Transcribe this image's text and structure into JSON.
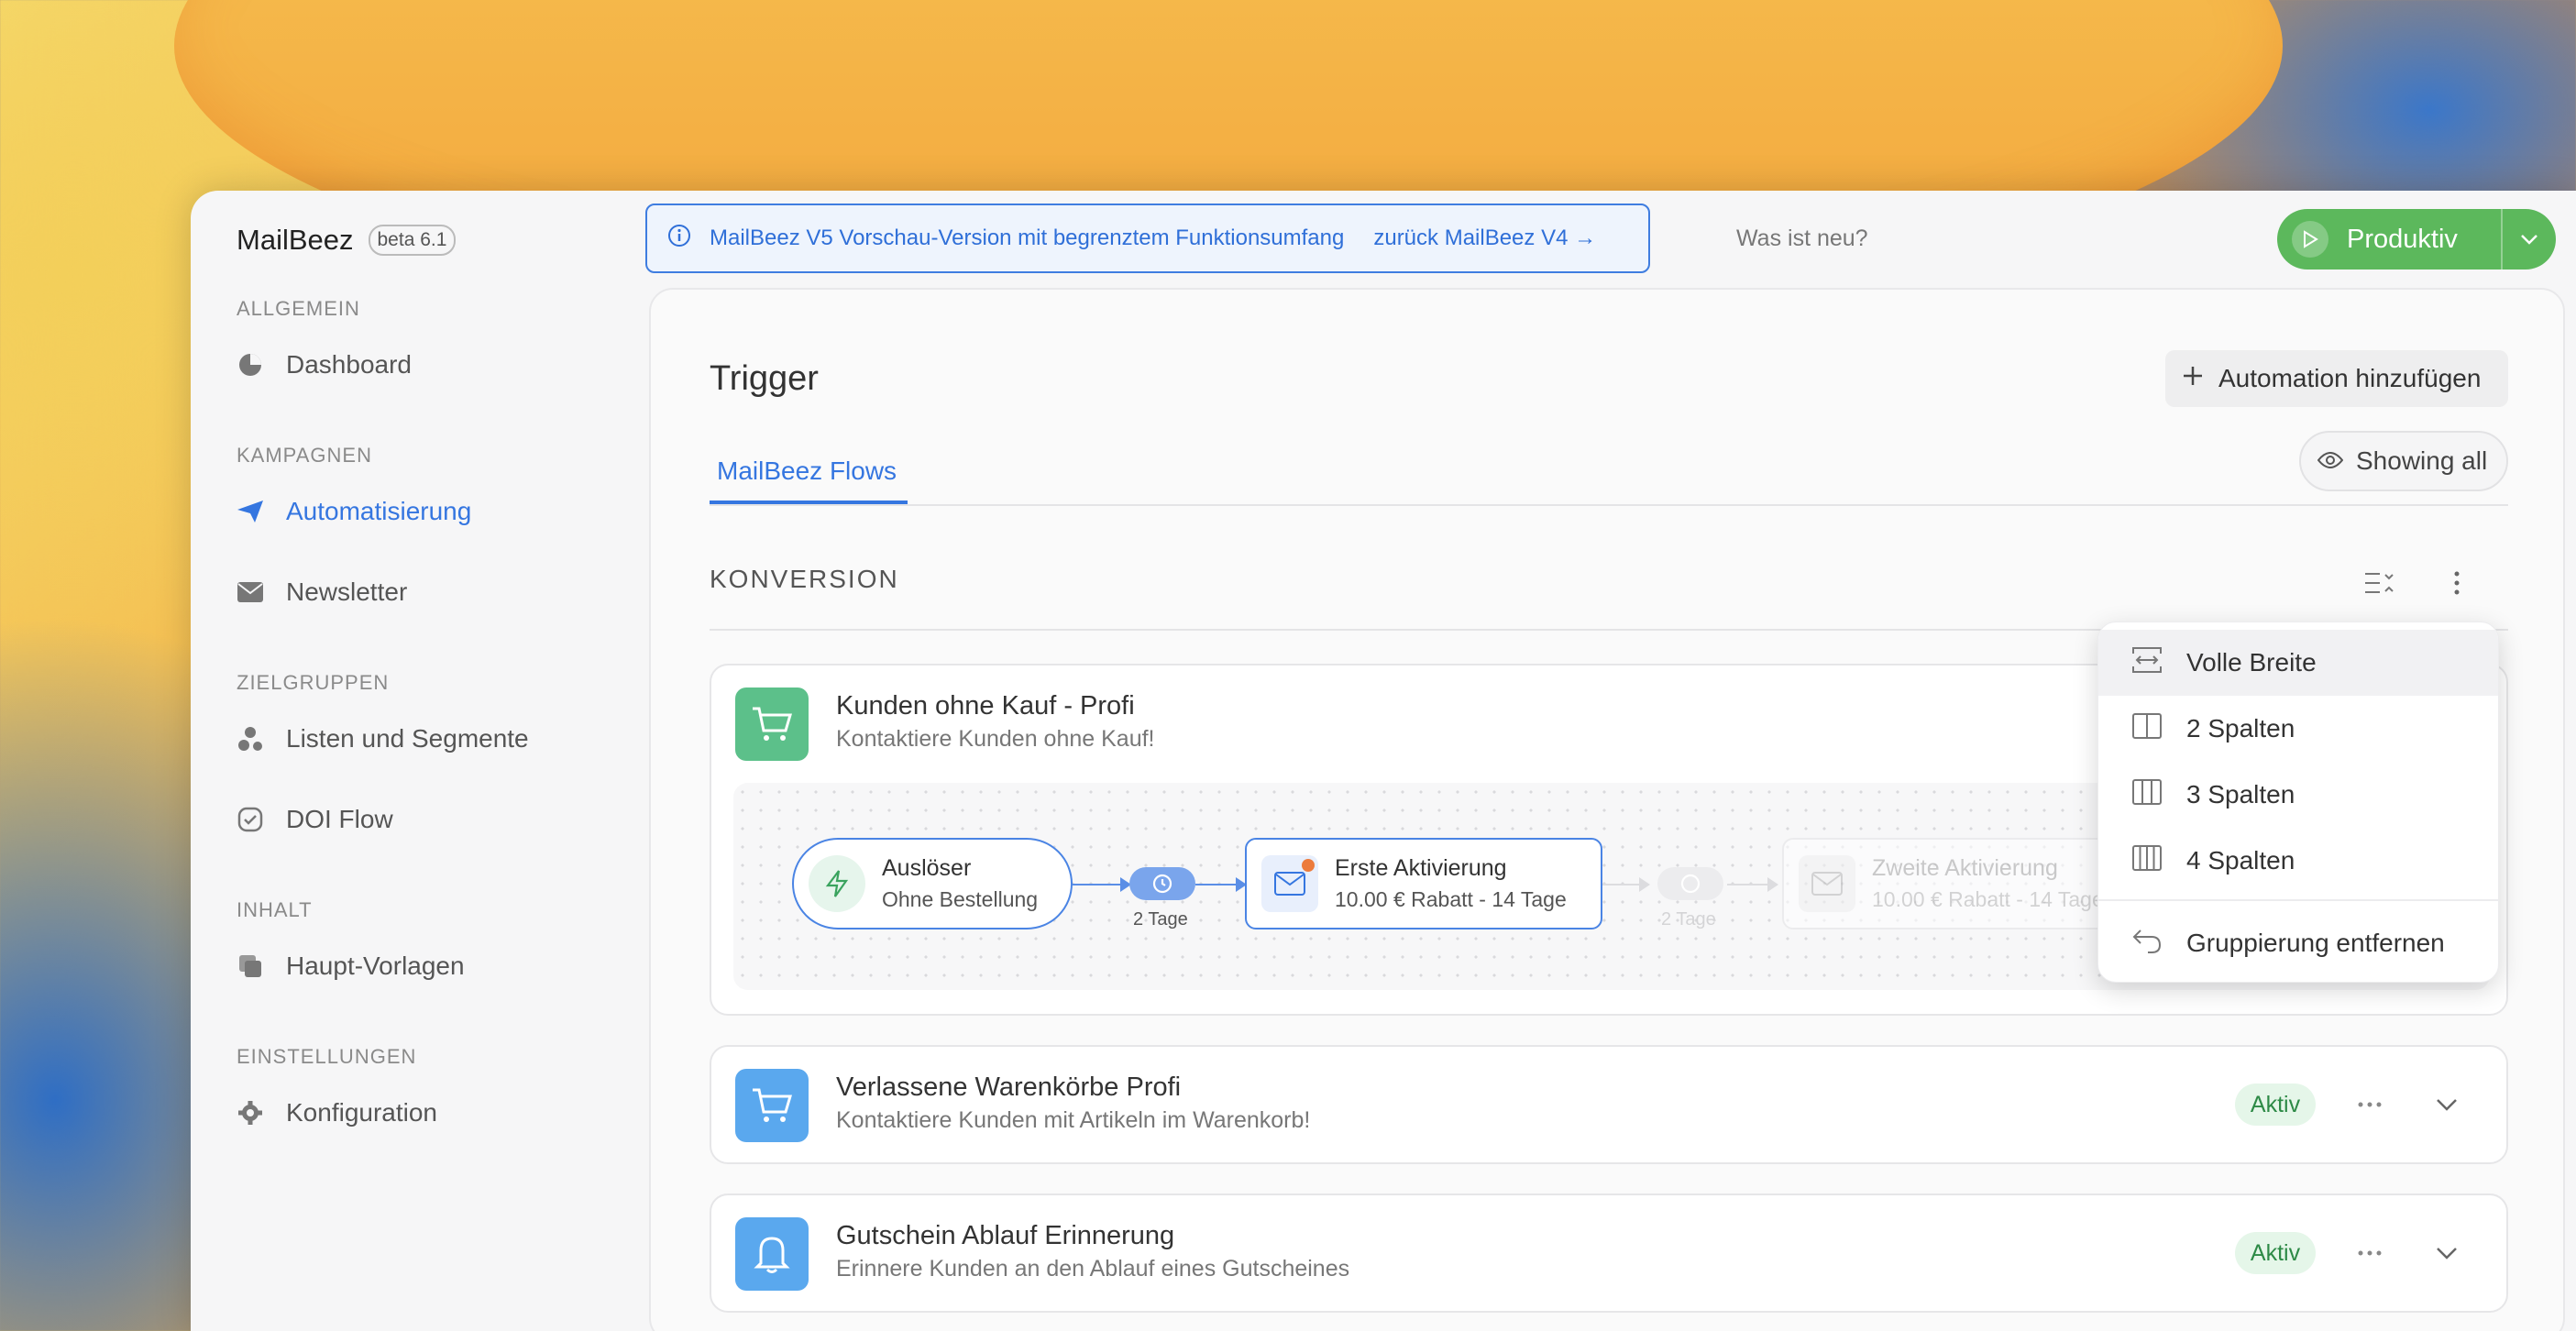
{
  "brand": {
    "name": "MailBeez",
    "badge": "beta 6.1"
  },
  "sidebar": {
    "sections": [
      {
        "label": "ALLGEMEIN",
        "items": [
          {
            "label": "Dashboard",
            "icon": "pie-chart-icon"
          }
        ]
      },
      {
        "label": "KAMPAGNEN",
        "items": [
          {
            "label": "Automatisierung",
            "icon": "paper-plane-icon",
            "active": true
          },
          {
            "label": "Newsletter",
            "icon": "envelope-icon"
          }
        ]
      },
      {
        "label": "ZIELGRUPPEN",
        "items": [
          {
            "label": "Listen und Segmente",
            "icon": "segments-icon"
          },
          {
            "label": "DOI Flow",
            "icon": "check-badge-icon"
          }
        ]
      },
      {
        "label": "INHALT",
        "items": [
          {
            "label": "Haupt-Vorlagen",
            "icon": "copy-icon"
          }
        ]
      },
      {
        "label": "EINSTELLUNGEN",
        "items": [
          {
            "label": "Konfiguration",
            "icon": "gear-icon"
          }
        ]
      }
    ]
  },
  "banner": {
    "text": "MailBeez V5 Vorschau-Version mit begrenztem Funktionsumfang",
    "link": "zurück MailBeez V4 →"
  },
  "header": {
    "whats_new": "Was ist neu?",
    "mode_label": "Produktiv"
  },
  "page": {
    "title": "Trigger",
    "add_button": "Automation hinzufügen",
    "tab": "MailBeez Flows",
    "showing": "Showing all",
    "group": "KONVERSION"
  },
  "cards": [
    {
      "title": "Kunden ohne Kauf - Profi",
      "subtitle": "Kontaktiere Kunden ohne Kauf!",
      "icon": "cart-icon",
      "color": "#5cc08a",
      "flow": {
        "trigger": {
          "title": "Auslöser",
          "sub": "Ohne Bestellung"
        },
        "delay1": "2 Tage",
        "mail1": {
          "title": "Erste Aktivierung",
          "sub": "10.00 € Rabatt - 14 Tage"
        },
        "delay2": "2 Tage",
        "mail2": {
          "title": "Zweite Aktivierung",
          "sub": "10.00 € Rabatt - 14 Tage"
        }
      }
    },
    {
      "title": "Verlassene Warenkörbe Profi",
      "subtitle": "Kontaktiere Kunden mit Artikeln im Warenkorb!",
      "icon": "cart-icon",
      "color": "#5aa8ee",
      "status": "Aktiv"
    },
    {
      "title": "Gutschein Ablauf Erinnerung",
      "subtitle": "Erinnere Kunden an den Ablauf eines Gutscheines",
      "icon": "bell-icon",
      "color": "#5aa8ee",
      "status": "Aktiv"
    }
  ],
  "menu": {
    "items": [
      {
        "label": "Volle Breite",
        "icon": "full-width-icon"
      },
      {
        "label": "2 Spalten",
        "icon": "two-columns-icon"
      },
      {
        "label": "3 Spalten",
        "icon": "three-columns-icon"
      },
      {
        "label": "4 Spalten",
        "icon": "four-columns-icon"
      }
    ],
    "remove": {
      "label": "Gruppierung entfernen",
      "icon": "undo-icon"
    }
  },
  "colors": {
    "accent": "#3576e0",
    "success": "#5cb85c",
    "active_badge_bg": "#e5f6e9",
    "active_badge_text": "#2d8a46"
  }
}
